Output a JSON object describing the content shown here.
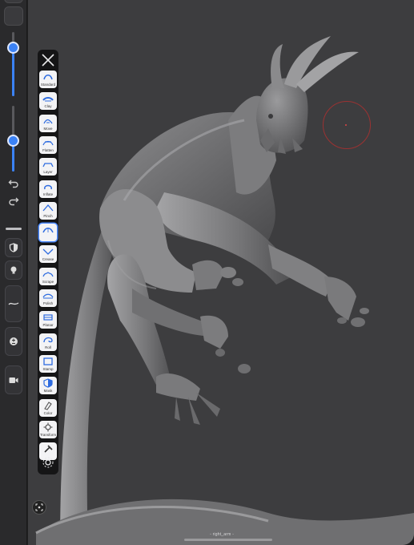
{
  "colors": {
    "accent": "#3b82f6",
    "viewport_bg": "#3d3d3f",
    "cursor": "#9b3232"
  },
  "brush_size": {
    "value_pct": 76
  },
  "brush_opacity": {
    "value_pct": 47
  },
  "tools": [
    {
      "label": "Standard",
      "icon": "standard-icon",
      "active": false
    },
    {
      "label": "Clay",
      "icon": "clay-icon",
      "active": false
    },
    {
      "label": "Move",
      "icon": "move-icon",
      "active": false
    },
    {
      "label": "Flatten",
      "icon": "flatten-icon",
      "active": false
    },
    {
      "label": "Layer",
      "icon": "layer-icon",
      "active": false
    },
    {
      "label": "Inflate",
      "icon": "inflate-icon",
      "active": false
    },
    {
      "label": "Pinch",
      "icon": "pinch-icon",
      "active": false
    },
    {
      "label": "",
      "icon": "crease-brush-icon",
      "active": true
    },
    {
      "label": "Crease",
      "icon": "crease-icon",
      "active": false
    },
    {
      "label": "Scrape",
      "icon": "scrape-icon",
      "active": false
    },
    {
      "label": "Polish",
      "icon": "polish-icon",
      "active": false
    },
    {
      "label": "Planar",
      "icon": "planar-icon",
      "active": false
    },
    {
      "label": "Roll",
      "icon": "roll-icon",
      "active": false
    },
    {
      "label": "Stamp",
      "icon": "stamp-icon",
      "active": false
    },
    {
      "label": "Mask",
      "icon": "mask-icon",
      "active": false
    },
    {
      "label": "Color",
      "icon": "color-icon",
      "active": false
    },
    {
      "label": "Transform",
      "icon": "transform-icon",
      "active": false
    },
    {
      "label": "",
      "icon": "hammer-icon",
      "active": false
    }
  ],
  "viewport": {
    "object_name": "right_arm"
  }
}
